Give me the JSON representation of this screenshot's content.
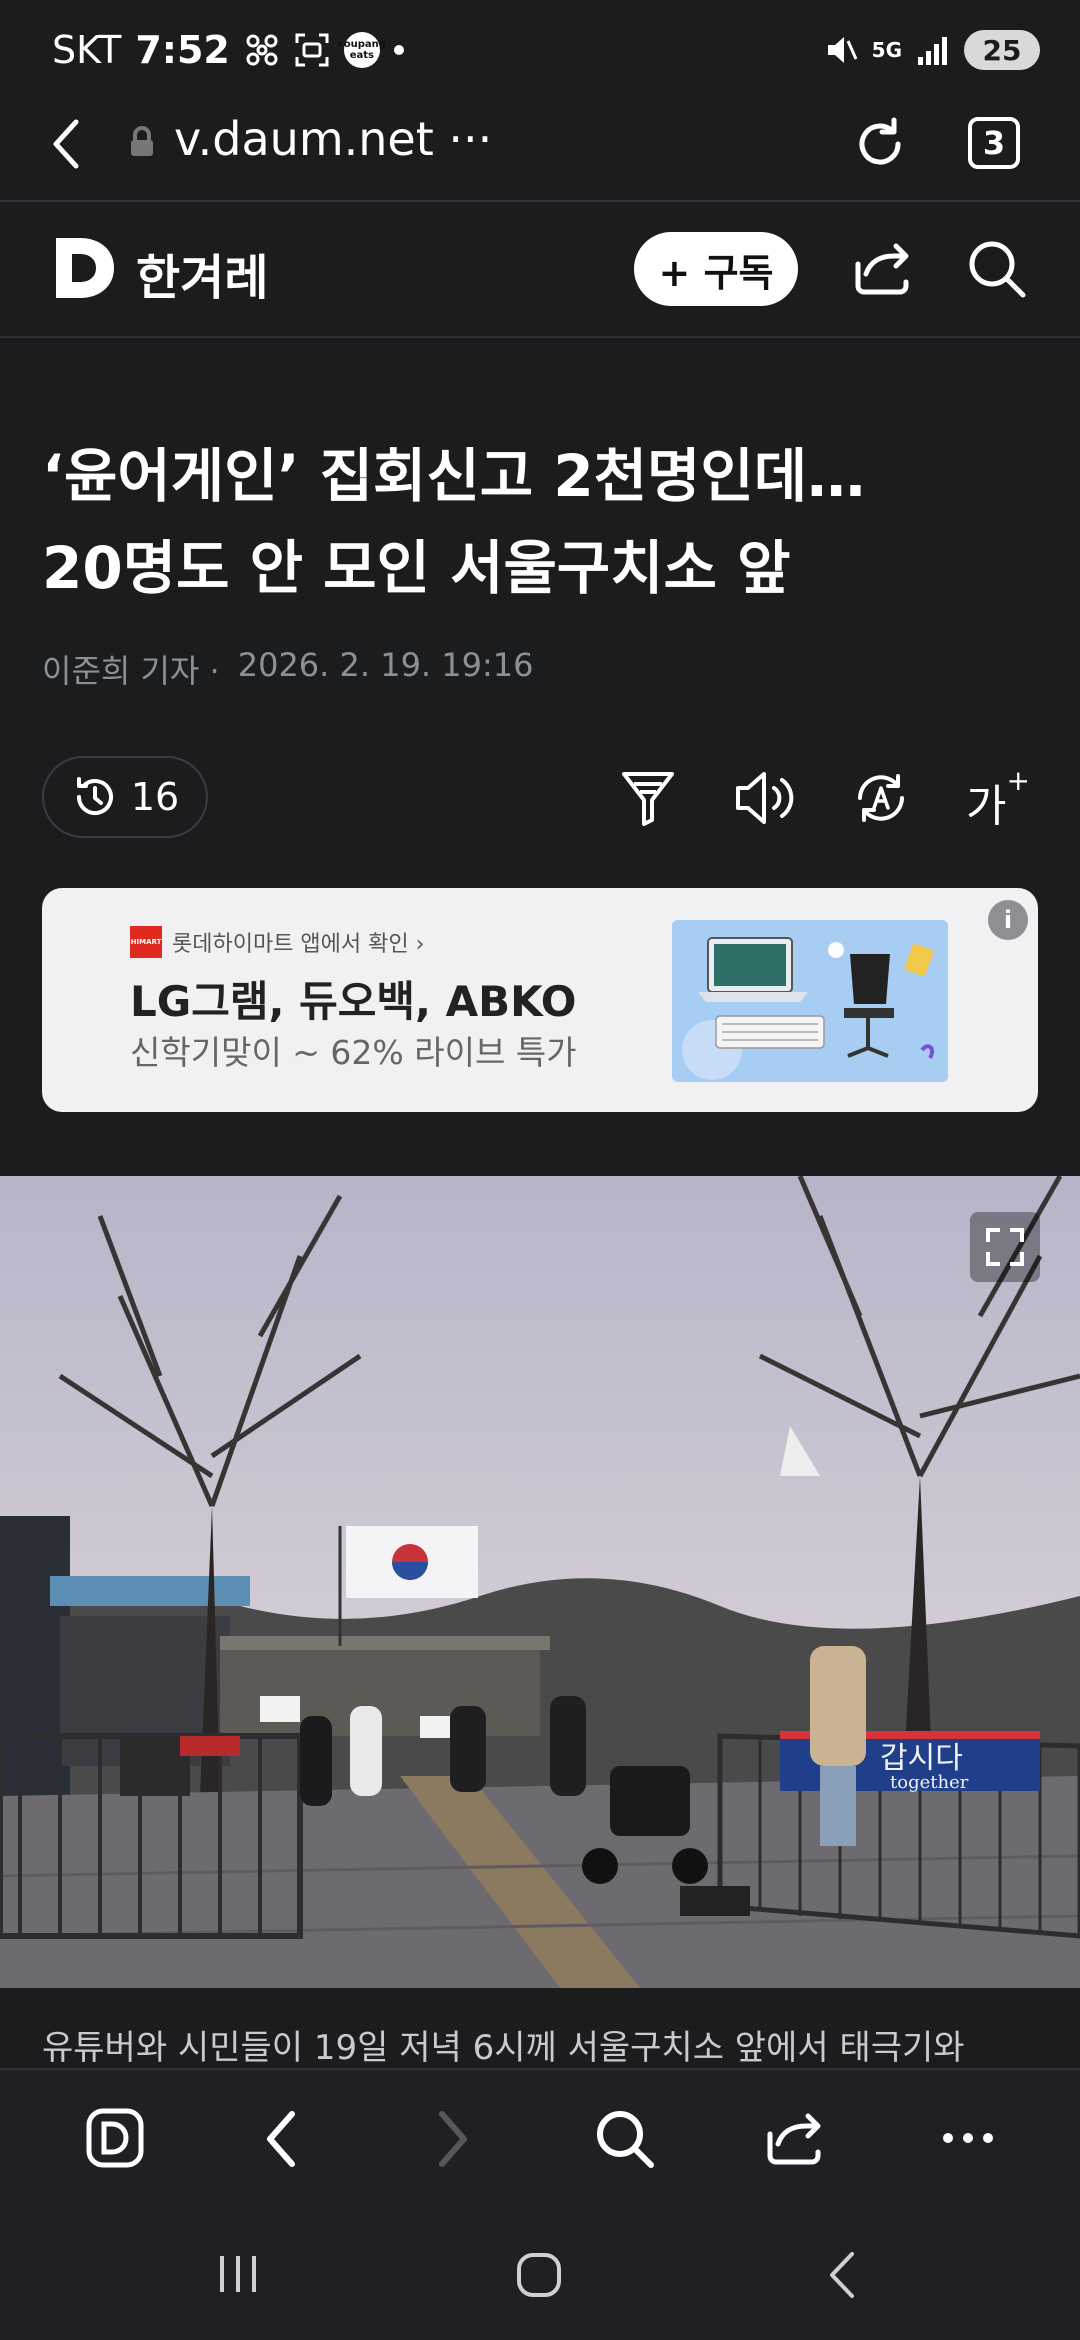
{
  "status_bar": {
    "carrier": "SKT",
    "time": "7:52",
    "eats_badge": "coupang eats",
    "network": "5G",
    "battery": "25"
  },
  "browser": {
    "url": "v.daum.net ···",
    "tab_count": "3"
  },
  "site_header": {
    "publisher": "한겨레",
    "subscribe_label": "+ 구독"
  },
  "article": {
    "headline_line1": "‘윤어게인’ 집회신고 2천명인데…",
    "headline_line2": "20명도 안 모인 서울구치소 앞",
    "author": "이준희 기자 ·",
    "date": "2026. 2. 19. 19:16",
    "read_count": "16",
    "font_size_label": "가",
    "caption": "유튜버와 시민들이 19일 저녁 6시께 서울구치소 앞에서 태극기와"
  },
  "ad": {
    "source": "롯데하이마트 앱에서 확인 ›",
    "logo_text": "HIMART",
    "title": "LG그램, 듀오백, ABKO",
    "description": "신학기맞이 ~ 62% 라이브 특가",
    "info": "i"
  },
  "photo": {
    "banner_text": "갑시다",
    "banner_subtext": "together"
  },
  "icons": [
    "back-icon",
    "lock-icon",
    "reload-icon",
    "share-icon",
    "search-icon",
    "filter-icon",
    "speaker-icon",
    "translate-icon",
    "fullscreen-icon",
    "daum-home-icon",
    "forward-icon",
    "more-icon",
    "recents-icon",
    "home-icon"
  ],
  "colors": {
    "background": "#1b1c1e",
    "ad_background": "#f1f1f3",
    "ad_logo": "#e02a20"
  }
}
